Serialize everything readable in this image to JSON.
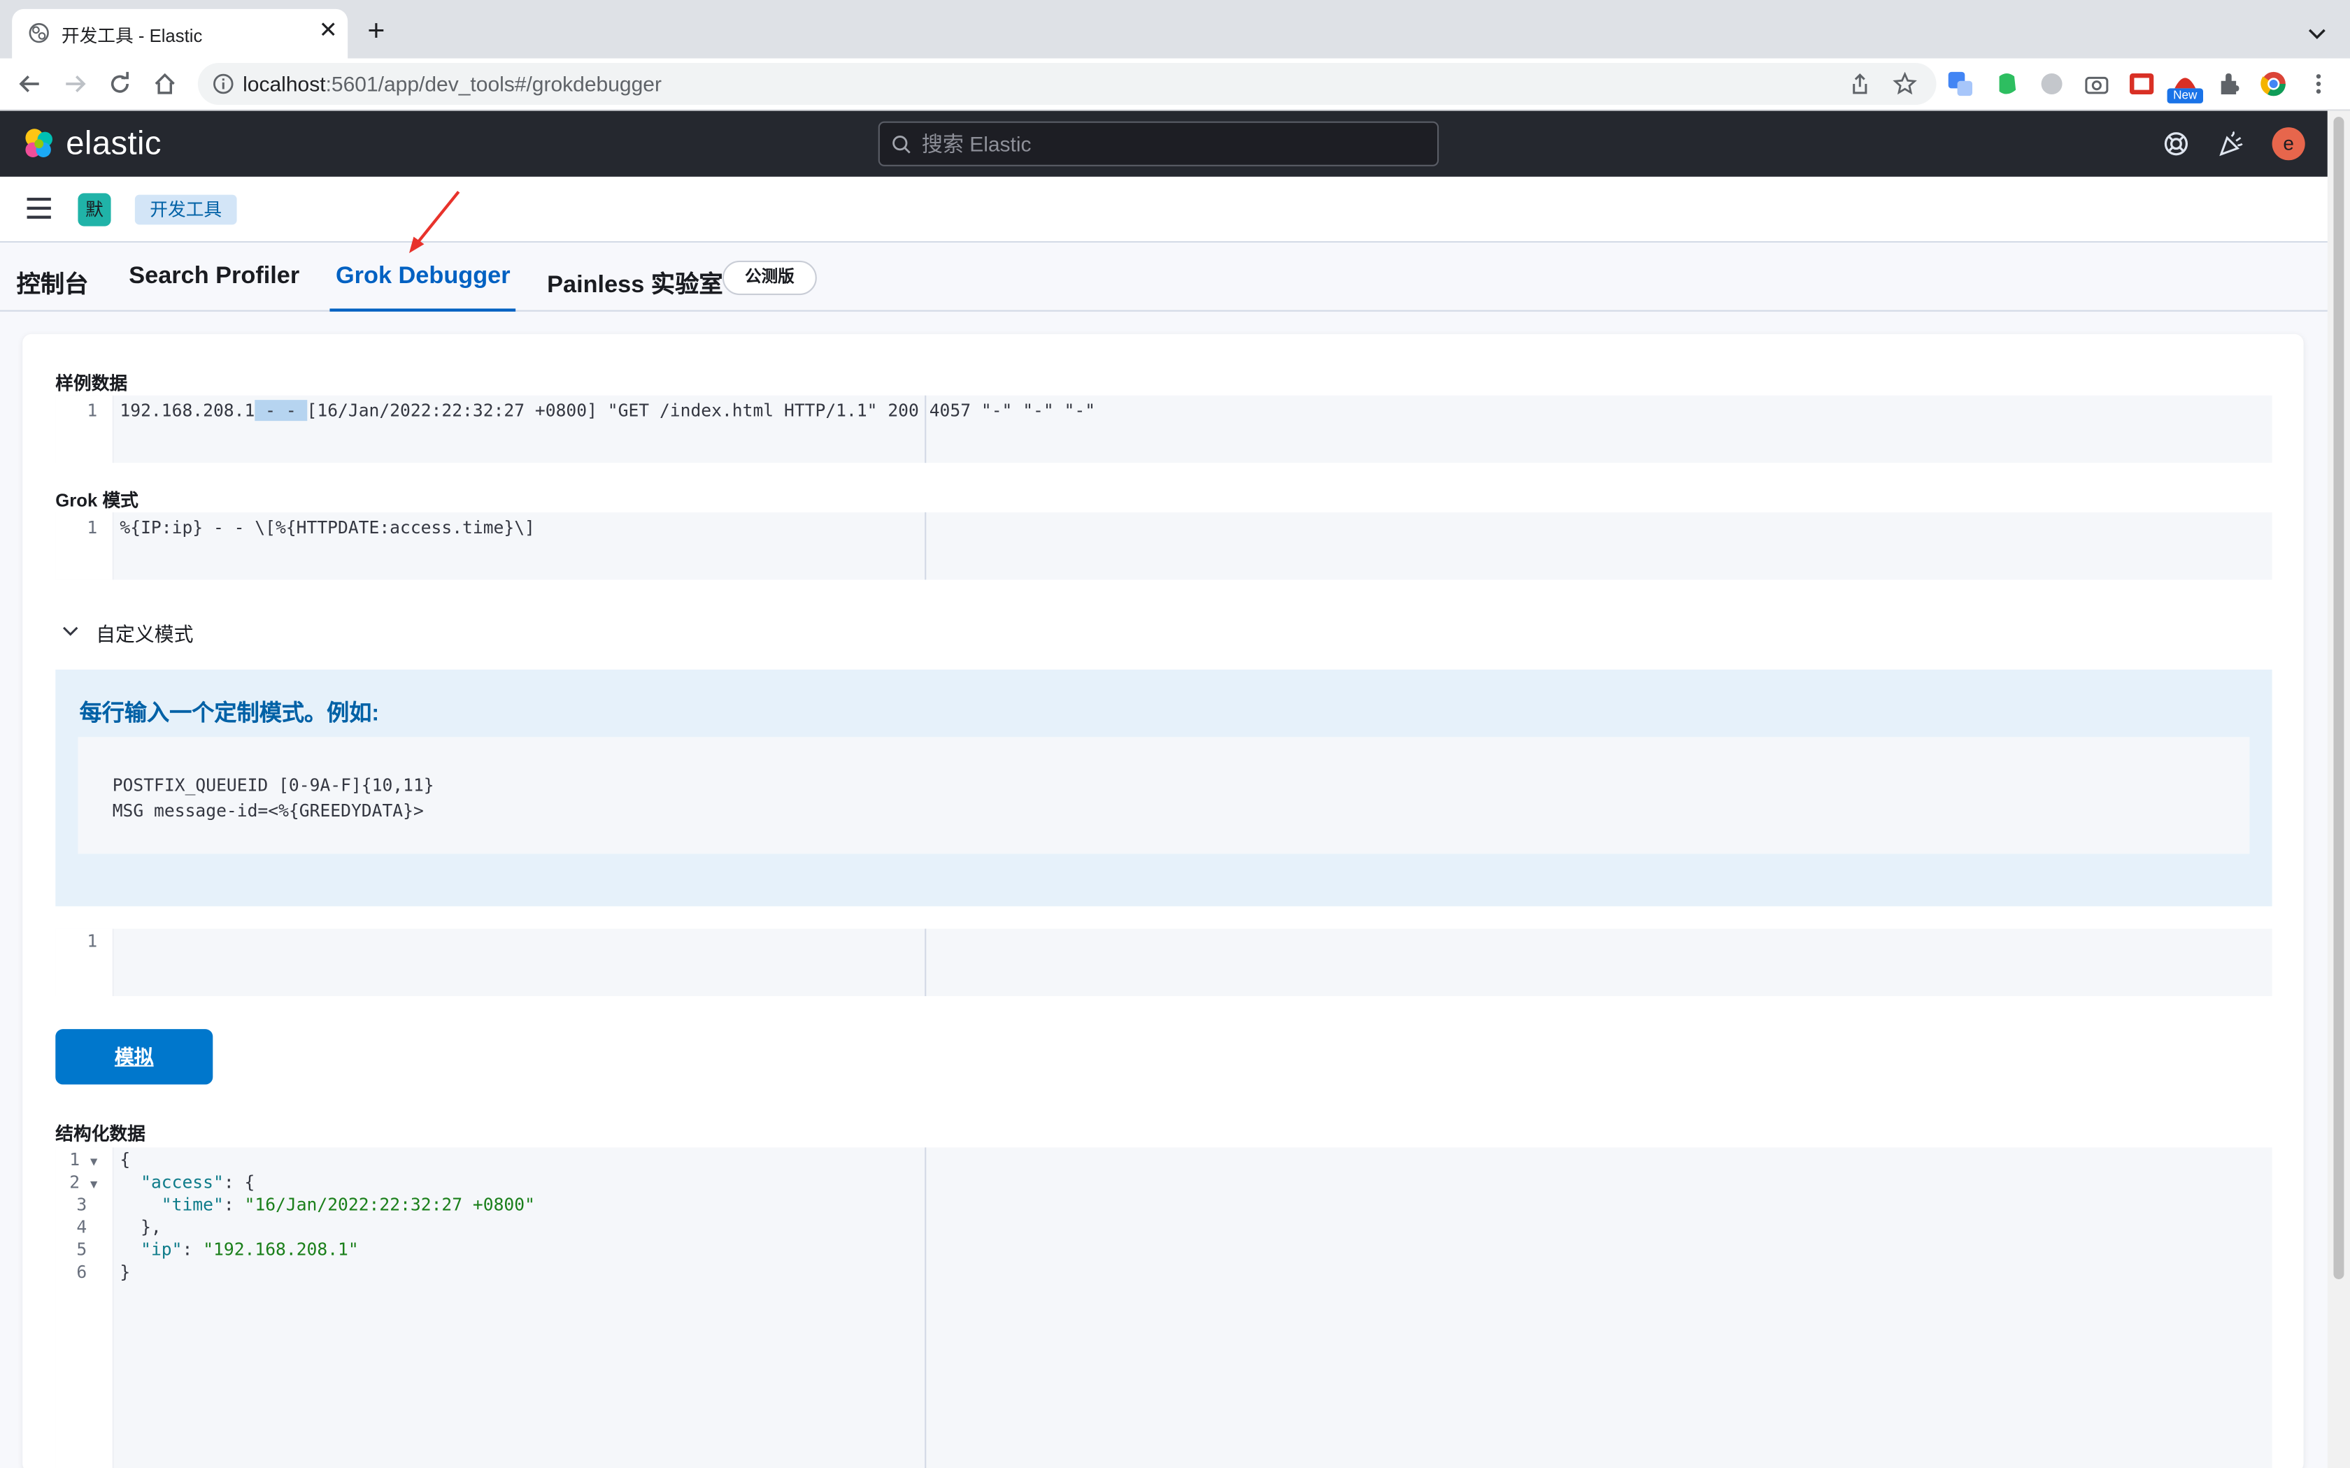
{
  "browser": {
    "tab_title": "开发工具 - Elastic",
    "url_host": "localhost",
    "url_path": ":5601/app/dev_tools#/grokdebugger",
    "new_badge": "New"
  },
  "header": {
    "logo_text": "elastic",
    "search_placeholder": "搜索 Elastic",
    "avatar_initial": "e"
  },
  "breadcrumbs": {
    "space_initial": "默",
    "current": "开发工具"
  },
  "devtools_tabs": [
    {
      "label": "控制台",
      "active": false
    },
    {
      "label": "Search Profiler",
      "active": false
    },
    {
      "label": "Grok Debugger",
      "active": true
    },
    {
      "label": "Painless 实验室",
      "active": false
    }
  ],
  "beta_label": "公测版",
  "sample_data": {
    "label": "样例数据",
    "line_number": "1",
    "text_ip": "192.168.208.1",
    "text_selected": " - - ",
    "text_rest": "[16/Jan/2022:22:32:27 +0800] \"GET /index.html HTTP/1.1\" 200 4057 \"-\" \"-\" \"-\""
  },
  "grok_pattern": {
    "label": "Grok 模式",
    "line_number": "1",
    "text": "%{IP:ip} - - \\[%{HTTPDATE:access.time}\\]"
  },
  "custom_patterns": {
    "toggle_label": "自定义模式",
    "callout_title": "每行输入一个定制模式。例如:",
    "examples": [
      "POSTFIX_QUEUEID [0-9A-F]{10,11}",
      "MSG message-id=<%{GREEDYDATA}>"
    ],
    "editor_line_number": "1"
  },
  "simulate_button": "模拟",
  "structured_data": {
    "label": "结构化数据",
    "line_numbers": [
      "1",
      "2",
      "3",
      "4",
      "5",
      "6"
    ],
    "lines": [
      {
        "parts": [
          {
            "t": "{",
            "c": "j-pun"
          }
        ]
      },
      {
        "parts": [
          {
            "t": "  ",
            "c": "j-pun"
          },
          {
            "t": "\"access\"",
            "c": "j-key"
          },
          {
            "t": ": {",
            "c": "j-pun"
          }
        ]
      },
      {
        "parts": [
          {
            "t": "    ",
            "c": "j-pun"
          },
          {
            "t": "\"time\"",
            "c": "j-key"
          },
          {
            "t": ": ",
            "c": "j-pun"
          },
          {
            "t": "\"16/Jan/2022:22:32:27 +0800\"",
            "c": "j-str"
          }
        ]
      },
      {
        "parts": [
          {
            "t": "  },",
            "c": "j-pun"
          }
        ]
      },
      {
        "parts": [
          {
            "t": "  ",
            "c": "j-pun"
          },
          {
            "t": "\"ip\"",
            "c": "j-key"
          },
          {
            "t": ": ",
            "c": "j-pun"
          },
          {
            "t": "\"192.168.208.1\"",
            "c": "j-str"
          }
        ]
      },
      {
        "parts": [
          {
            "t": "}",
            "c": "j-pun"
          }
        ]
      }
    ]
  }
}
